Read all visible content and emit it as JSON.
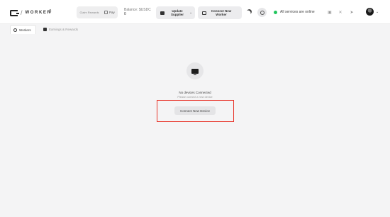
{
  "header": {
    "logo_text": "WORKER",
    "claim_rewards": "Claim Rewards",
    "pay_label": "Pay",
    "balance_label": "Balance: $USDC",
    "balance_value": "0",
    "update_label": "Update Supplier",
    "connect_new_worker": "Connect New Worker",
    "status_text": "All services are online",
    "status_color": "#22c55e"
  },
  "tabs": [
    {
      "label": "Workers",
      "icon": "gear-icon",
      "active": true
    },
    {
      "label": "Earnings & Rewards",
      "icon": "gift-icon",
      "active": false
    }
  ],
  "empty_state": {
    "title": "No devices Connected",
    "subtitle": "Please connect a new device",
    "button_label": "Connect New Device",
    "icon": "monitor-icon"
  },
  "annotation": {
    "highlight_color": "#e8352b"
  }
}
